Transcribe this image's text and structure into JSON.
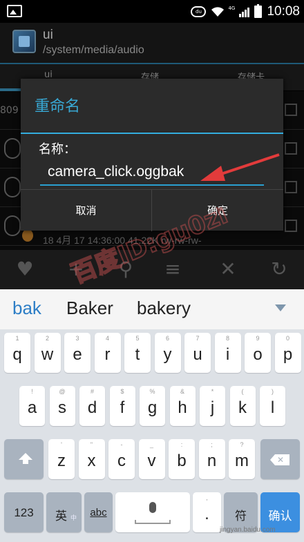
{
  "status_bar": {
    "cloud": "du",
    "network": "4G",
    "time": "10:08"
  },
  "app": {
    "title": "ui",
    "path": "/system/media/audio",
    "tabs": [
      "ui",
      "存储",
      "存储卡"
    ],
    "row_num": "809",
    "row_meta": "18 4月 17 14:36:00  41.22K  rw-rw-rw-"
  },
  "dialog": {
    "title": "重命名",
    "field_label": "名称：",
    "filename": "camera_click.oggbak",
    "cancel_label": "取消",
    "confirm_label": "确定"
  },
  "suggestions": [
    "bak",
    "Baker",
    "bakery"
  ],
  "keyboard": {
    "row1": [
      {
        "hint": "1",
        "key": "q"
      },
      {
        "hint": "2",
        "key": "w"
      },
      {
        "hint": "3",
        "key": "e"
      },
      {
        "hint": "4",
        "key": "r"
      },
      {
        "hint": "5",
        "key": "t"
      },
      {
        "hint": "6",
        "key": "y"
      },
      {
        "hint": "7",
        "key": "u"
      },
      {
        "hint": "8",
        "key": "i"
      },
      {
        "hint": "9",
        "key": "o"
      },
      {
        "hint": "0",
        "key": "p"
      }
    ],
    "row2": [
      {
        "hint": "!",
        "key": "a"
      },
      {
        "hint": "@",
        "key": "s"
      },
      {
        "hint": "#",
        "key": "d"
      },
      {
        "hint": "$",
        "key": "f"
      },
      {
        "hint": "%",
        "key": "g"
      },
      {
        "hint": "&",
        "key": "h"
      },
      {
        "hint": "*",
        "key": "j"
      },
      {
        "hint": "(",
        "key": "k"
      },
      {
        "hint": ")",
        "key": "l"
      }
    ],
    "row3": [
      {
        "hint": "'",
        "key": "z"
      },
      {
        "hint": "\"",
        "key": "x"
      },
      {
        "hint": "-",
        "key": "c"
      },
      {
        "hint": "_",
        "key": "v"
      },
      {
        "hint": ":",
        "key": "b"
      },
      {
        "hint": ";",
        "key": "n"
      },
      {
        "hint": "?",
        "key": "m"
      }
    ],
    "num_label": "123",
    "lang_label": "英",
    "lang_sub": "中",
    "abc_label": "abc",
    "period_hint": ",",
    "period_label": ".",
    "symbol_label": "符",
    "enter_label": "确认"
  },
  "watermark": {
    "text": "百度ID:gu0zi",
    "site": "jingyan.baidu.com"
  },
  "colors": {
    "accent": "#33aee0",
    "enter_key": "#3c8fe0",
    "suggest_active": "#2d7ec6",
    "arrow": "#e23b3b"
  },
  "icons": [
    "heart-icon",
    "plus-icon",
    "search-icon",
    "list-icon",
    "close-icon",
    "refresh-icon"
  ]
}
